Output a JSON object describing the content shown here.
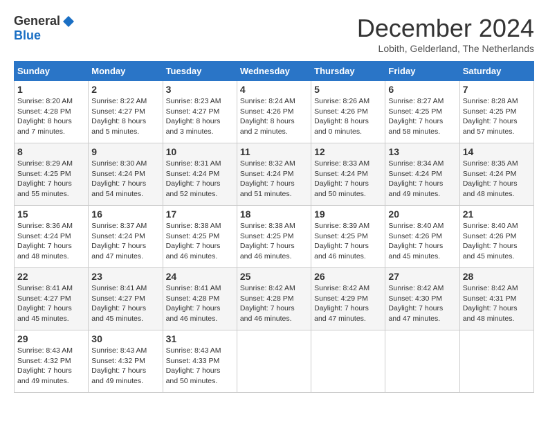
{
  "logo": {
    "general": "General",
    "blue": "Blue"
  },
  "title": "December 2024",
  "location": "Lobith, Gelderland, The Netherlands",
  "headers": [
    "Sunday",
    "Monday",
    "Tuesday",
    "Wednesday",
    "Thursday",
    "Friday",
    "Saturday"
  ],
  "weeks": [
    [
      {
        "day": "1",
        "sunrise": "8:20 AM",
        "sunset": "4:28 PM",
        "daylight": "8 hours and 7 minutes."
      },
      {
        "day": "2",
        "sunrise": "8:22 AM",
        "sunset": "4:27 PM",
        "daylight": "8 hours and 5 minutes."
      },
      {
        "day": "3",
        "sunrise": "8:23 AM",
        "sunset": "4:27 PM",
        "daylight": "8 hours and 3 minutes."
      },
      {
        "day": "4",
        "sunrise": "8:24 AM",
        "sunset": "4:26 PM",
        "daylight": "8 hours and 2 minutes."
      },
      {
        "day": "5",
        "sunrise": "8:26 AM",
        "sunset": "4:26 PM",
        "daylight": "8 hours and 0 minutes."
      },
      {
        "day": "6",
        "sunrise": "8:27 AM",
        "sunset": "4:25 PM",
        "daylight": "7 hours and 58 minutes."
      },
      {
        "day": "7",
        "sunrise": "8:28 AM",
        "sunset": "4:25 PM",
        "daylight": "7 hours and 57 minutes."
      }
    ],
    [
      {
        "day": "8",
        "sunrise": "8:29 AM",
        "sunset": "4:25 PM",
        "daylight": "7 hours and 55 minutes."
      },
      {
        "day": "9",
        "sunrise": "8:30 AM",
        "sunset": "4:24 PM",
        "daylight": "7 hours and 54 minutes."
      },
      {
        "day": "10",
        "sunrise": "8:31 AM",
        "sunset": "4:24 PM",
        "daylight": "7 hours and 52 minutes."
      },
      {
        "day": "11",
        "sunrise": "8:32 AM",
        "sunset": "4:24 PM",
        "daylight": "7 hours and 51 minutes."
      },
      {
        "day": "12",
        "sunrise": "8:33 AM",
        "sunset": "4:24 PM",
        "daylight": "7 hours and 50 minutes."
      },
      {
        "day": "13",
        "sunrise": "8:34 AM",
        "sunset": "4:24 PM",
        "daylight": "7 hours and 49 minutes."
      },
      {
        "day": "14",
        "sunrise": "8:35 AM",
        "sunset": "4:24 PM",
        "daylight": "7 hours and 48 minutes."
      }
    ],
    [
      {
        "day": "15",
        "sunrise": "8:36 AM",
        "sunset": "4:24 PM",
        "daylight": "7 hours and 48 minutes."
      },
      {
        "day": "16",
        "sunrise": "8:37 AM",
        "sunset": "4:24 PM",
        "daylight": "7 hours and 47 minutes."
      },
      {
        "day": "17",
        "sunrise": "8:38 AM",
        "sunset": "4:25 PM",
        "daylight": "7 hours and 46 minutes."
      },
      {
        "day": "18",
        "sunrise": "8:38 AM",
        "sunset": "4:25 PM",
        "daylight": "7 hours and 46 minutes."
      },
      {
        "day": "19",
        "sunrise": "8:39 AM",
        "sunset": "4:25 PM",
        "daylight": "7 hours and 46 minutes."
      },
      {
        "day": "20",
        "sunrise": "8:40 AM",
        "sunset": "4:26 PM",
        "daylight": "7 hours and 45 minutes."
      },
      {
        "day": "21",
        "sunrise": "8:40 AM",
        "sunset": "4:26 PM",
        "daylight": "7 hours and 45 minutes."
      }
    ],
    [
      {
        "day": "22",
        "sunrise": "8:41 AM",
        "sunset": "4:27 PM",
        "daylight": "7 hours and 45 minutes."
      },
      {
        "day": "23",
        "sunrise": "8:41 AM",
        "sunset": "4:27 PM",
        "daylight": "7 hours and 45 minutes."
      },
      {
        "day": "24",
        "sunrise": "8:41 AM",
        "sunset": "4:28 PM",
        "daylight": "7 hours and 46 minutes."
      },
      {
        "day": "25",
        "sunrise": "8:42 AM",
        "sunset": "4:28 PM",
        "daylight": "7 hours and 46 minutes."
      },
      {
        "day": "26",
        "sunrise": "8:42 AM",
        "sunset": "4:29 PM",
        "daylight": "7 hours and 47 minutes."
      },
      {
        "day": "27",
        "sunrise": "8:42 AM",
        "sunset": "4:30 PM",
        "daylight": "7 hours and 47 minutes."
      },
      {
        "day": "28",
        "sunrise": "8:42 AM",
        "sunset": "4:31 PM",
        "daylight": "7 hours and 48 minutes."
      }
    ],
    [
      {
        "day": "29",
        "sunrise": "8:43 AM",
        "sunset": "4:32 PM",
        "daylight": "7 hours and 49 minutes."
      },
      {
        "day": "30",
        "sunrise": "8:43 AM",
        "sunset": "4:32 PM",
        "daylight": "7 hours and 49 minutes."
      },
      {
        "day": "31",
        "sunrise": "8:43 AM",
        "sunset": "4:33 PM",
        "daylight": "7 hours and 50 minutes."
      },
      null,
      null,
      null,
      null
    ]
  ]
}
